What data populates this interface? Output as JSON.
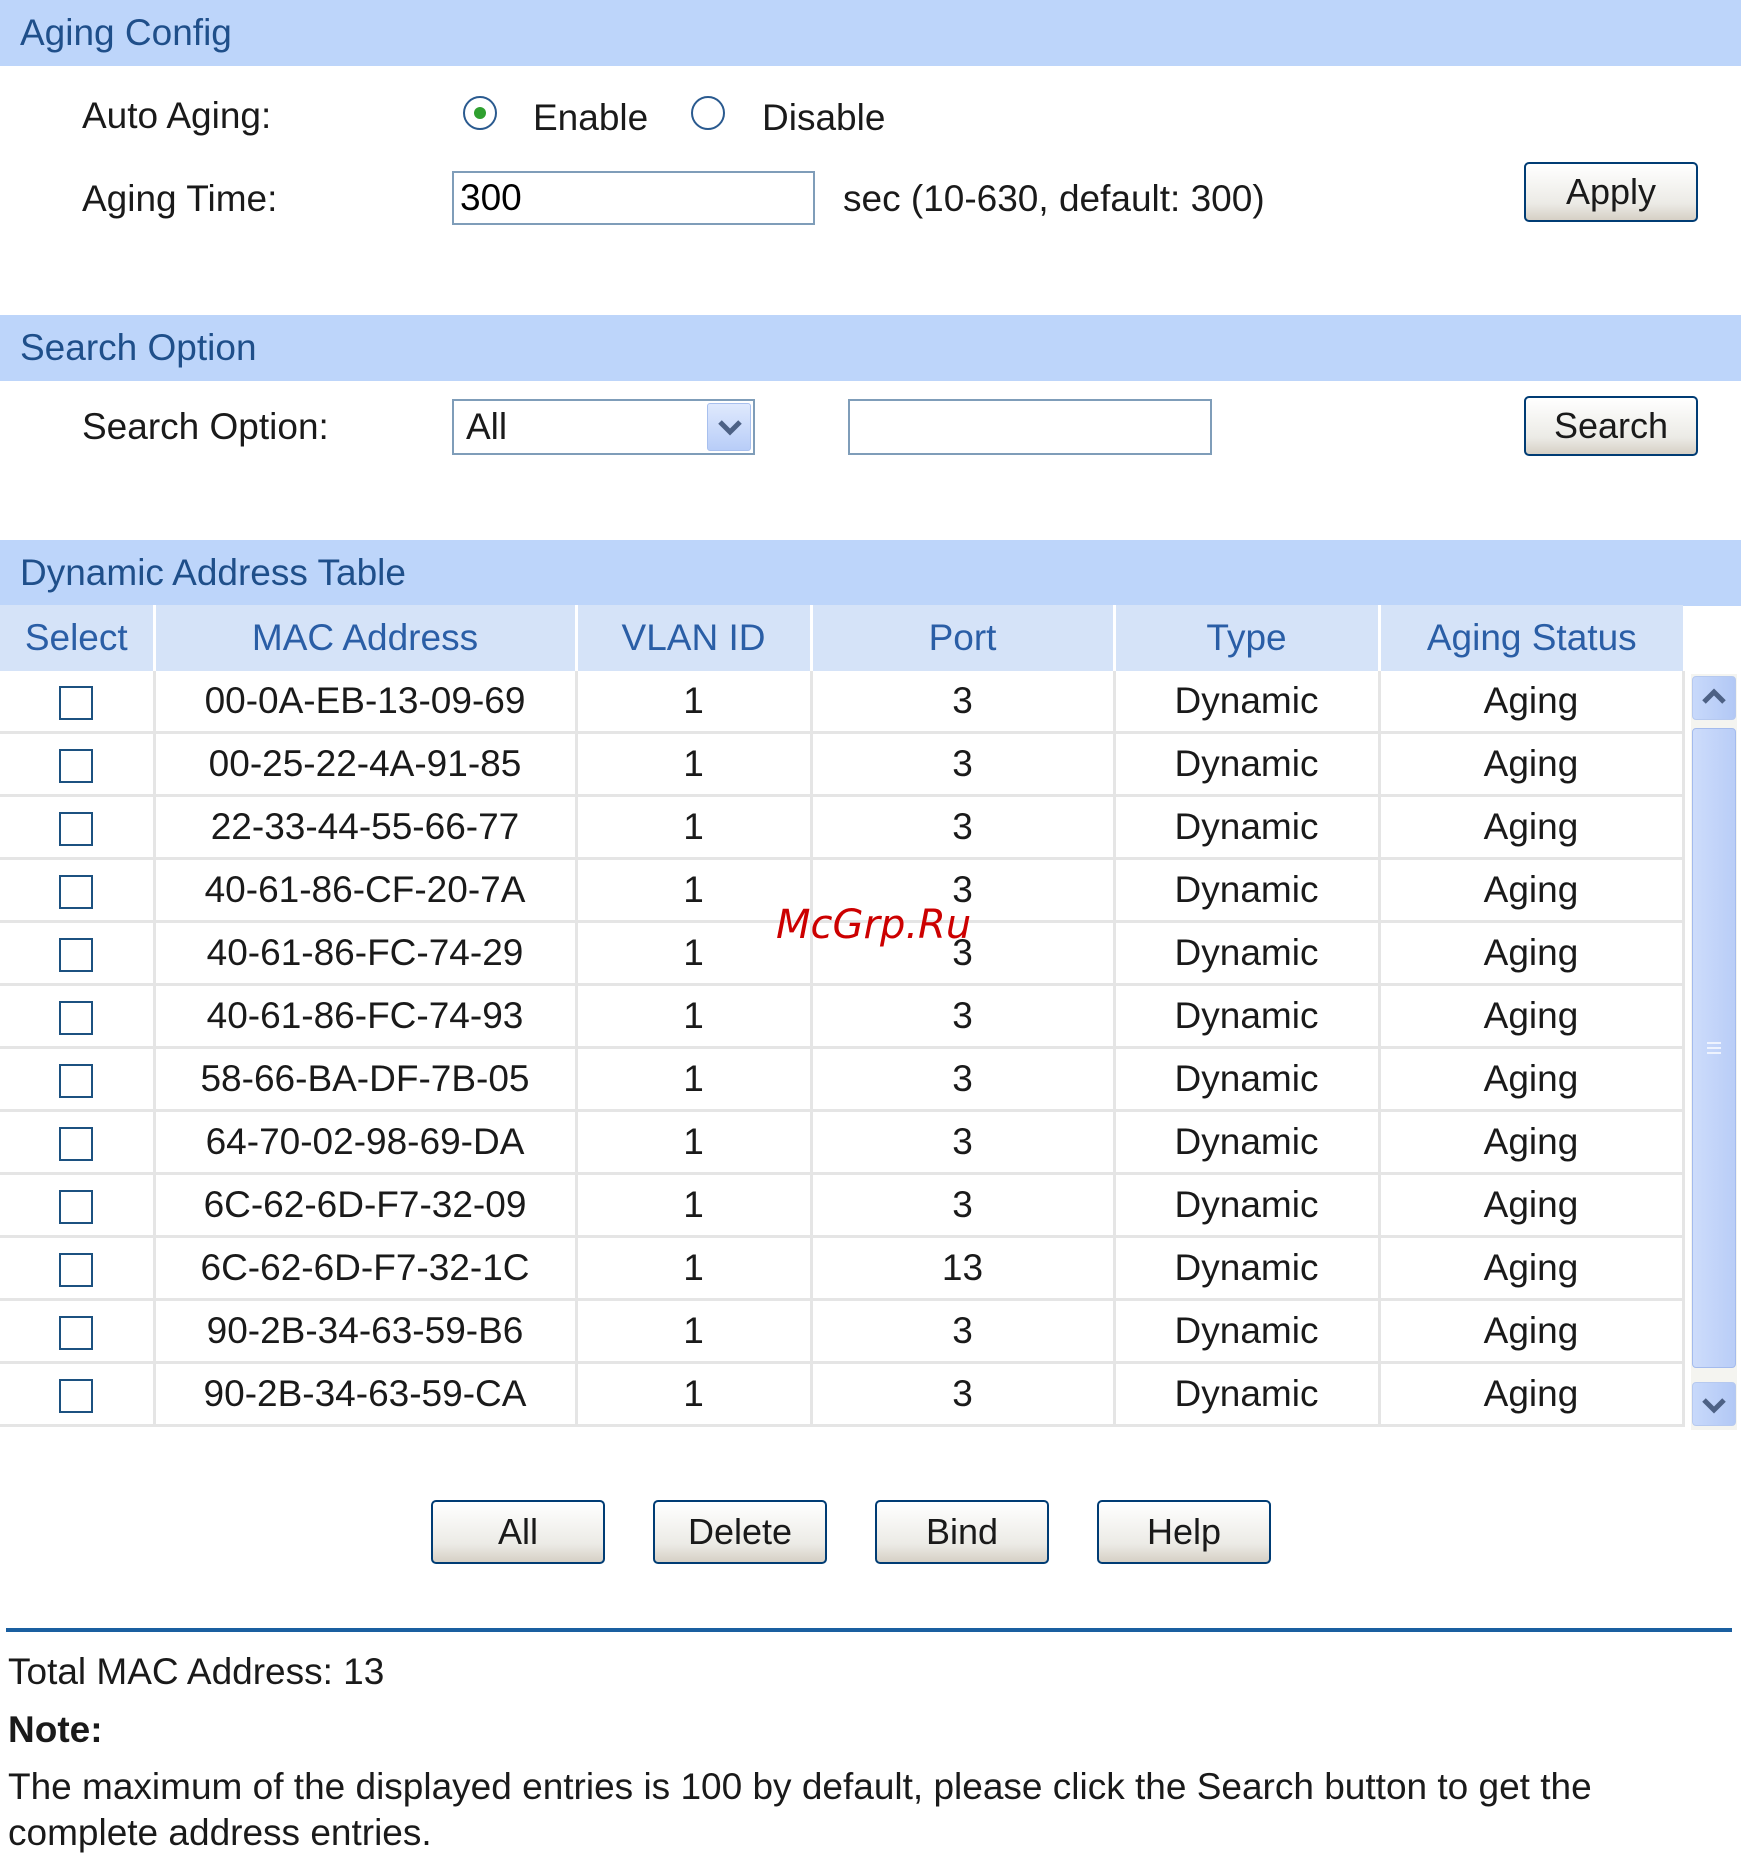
{
  "aging_config": {
    "header": "Aging Config",
    "auto_aging_label": "Auto Aging:",
    "enable_label": "Enable",
    "disable_label": "Disable",
    "auto_aging_value": "Enable",
    "aging_time_label": "Aging Time:",
    "aging_time_value": "300",
    "aging_time_hint": "sec (10-630, default: 300)",
    "apply_label": "Apply"
  },
  "search_option": {
    "header": "Search Option",
    "label": "Search Option:",
    "selected": "All",
    "text_value": "",
    "search_label": "Search"
  },
  "dynamic_table": {
    "header": "Dynamic Address Table",
    "columns": [
      "Select",
      "MAC Address",
      "VLAN ID",
      "Port",
      "Type",
      "Aging Status"
    ],
    "rows": [
      {
        "mac": "00-0A-EB-13-09-69",
        "vlan": "1",
        "port": "3",
        "type": "Dynamic",
        "status": "Aging"
      },
      {
        "mac": "00-25-22-4A-91-85",
        "vlan": "1",
        "port": "3",
        "type": "Dynamic",
        "status": "Aging"
      },
      {
        "mac": "22-33-44-55-66-77",
        "vlan": "1",
        "port": "3",
        "type": "Dynamic",
        "status": "Aging"
      },
      {
        "mac": "40-61-86-CF-20-7A",
        "vlan": "1",
        "port": "3",
        "type": "Dynamic",
        "status": "Aging"
      },
      {
        "mac": "40-61-86-FC-74-29",
        "vlan": "1",
        "port": "3",
        "type": "Dynamic",
        "status": "Aging"
      },
      {
        "mac": "40-61-86-FC-74-93",
        "vlan": "1",
        "port": "3",
        "type": "Dynamic",
        "status": "Aging"
      },
      {
        "mac": "58-66-BA-DF-7B-05",
        "vlan": "1",
        "port": "3",
        "type": "Dynamic",
        "status": "Aging"
      },
      {
        "mac": "64-70-02-98-69-DA",
        "vlan": "1",
        "port": "3",
        "type": "Dynamic",
        "status": "Aging"
      },
      {
        "mac": "6C-62-6D-F7-32-09",
        "vlan": "1",
        "port": "3",
        "type": "Dynamic",
        "status": "Aging"
      },
      {
        "mac": "6C-62-6D-F7-32-1C",
        "vlan": "1",
        "port": "13",
        "type": "Dynamic",
        "status": "Aging"
      },
      {
        "mac": "90-2B-34-63-59-B6",
        "vlan": "1",
        "port": "3",
        "type": "Dynamic",
        "status": "Aging"
      },
      {
        "mac": "90-2B-34-63-59-CA",
        "vlan": "1",
        "port": "3",
        "type": "Dynamic",
        "status": "Aging"
      }
    ]
  },
  "actions": {
    "all_label": "All",
    "delete_label": "Delete",
    "bind_label": "Bind",
    "help_label": "Help"
  },
  "footer": {
    "total": "Total MAC Address: 13",
    "note_title": "Note:",
    "note_text": "The maximum of the displayed entries is 100 by default, please click the Search button to get the complete address entries."
  },
  "watermark": "McGrp.Ru",
  "colors": {
    "section_header_bg": "#bdd5fa",
    "section_header_text": "#1f4f8a",
    "table_header_text": "#2a5ea6",
    "button_border": "#003c74",
    "divider": "#1a5fa0"
  }
}
